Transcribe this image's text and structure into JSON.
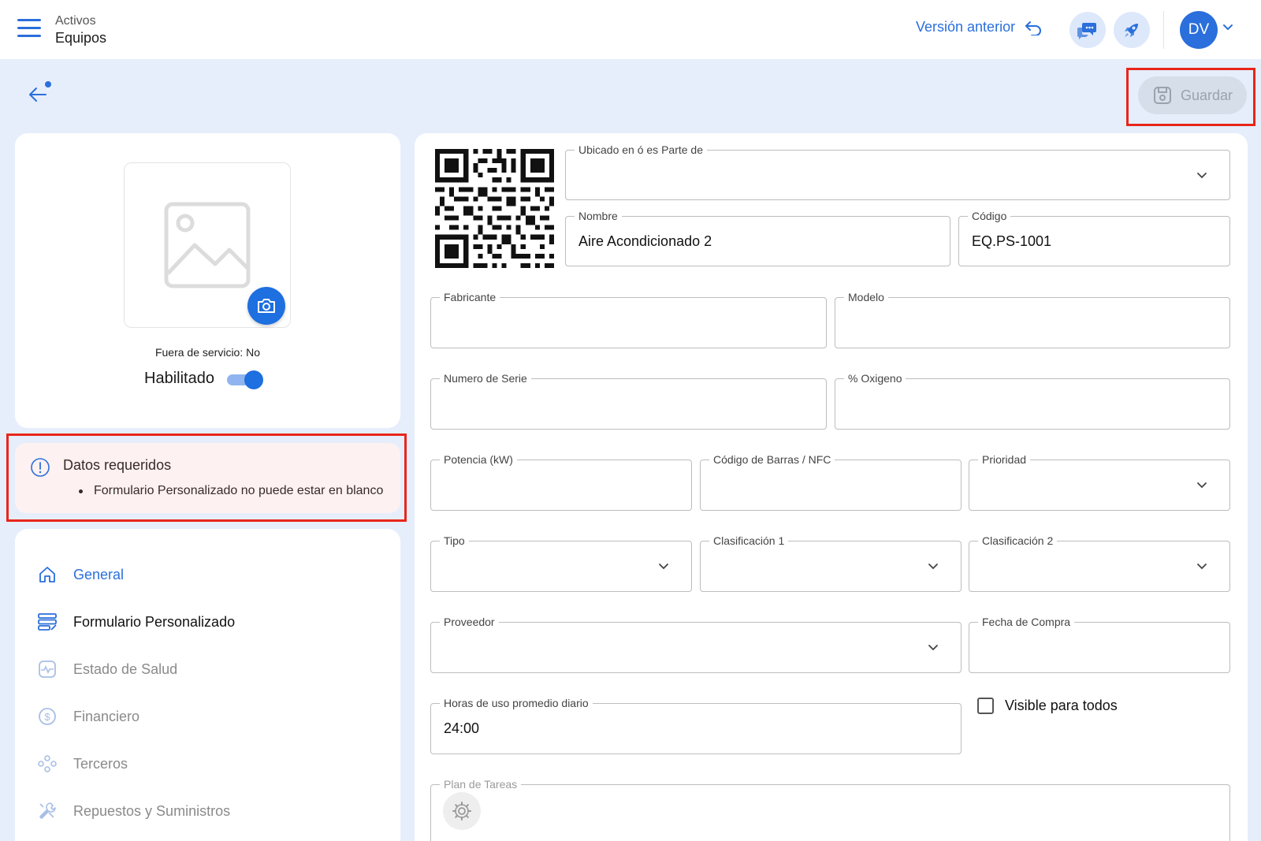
{
  "header": {
    "parent": "Activos",
    "title": "Equipos",
    "previous_version": "Versión anterior",
    "avatar_initials": "DV"
  },
  "toolbar": {
    "save_label": "Guardar"
  },
  "asset": {
    "out_of_service": "Fuera de servicio: No",
    "enabled_label": "Habilitado",
    "enabled": true
  },
  "alert": {
    "title": "Datos requeridos",
    "items": [
      "Formulario Personalizado no puede estar en blanco"
    ]
  },
  "nav": {
    "items": [
      {
        "label": "General",
        "icon": "home-icon",
        "state": "active"
      },
      {
        "label": "Formulario Personalizado",
        "icon": "form-icon",
        "state": "normal"
      },
      {
        "label": "Estado de Salud",
        "icon": "health-icon",
        "state": "disabled"
      },
      {
        "label": "Financiero",
        "icon": "dollar-icon",
        "state": "disabled"
      },
      {
        "label": "Terceros",
        "icon": "people-icon",
        "state": "disabled"
      },
      {
        "label": "Repuestos y Suministros",
        "icon": "tools-icon",
        "state": "disabled"
      }
    ]
  },
  "form": {
    "ubicado": {
      "label": "Ubicado en ó es Parte de",
      "value": ""
    },
    "nombre": {
      "label": "Nombre",
      "value": "Aire Acondicionado 2"
    },
    "codigo": {
      "label": "Código",
      "value": "EQ.PS-1001"
    },
    "fabricante": {
      "label": "Fabricante",
      "value": ""
    },
    "modelo": {
      "label": "Modelo",
      "value": ""
    },
    "serie": {
      "label": "Numero de Serie",
      "value": ""
    },
    "oxigeno": {
      "label": "% Oxigeno",
      "value": ""
    },
    "potencia": {
      "label": "Potencia (kW)",
      "value": ""
    },
    "barras": {
      "label": "Código de Barras / NFC",
      "value": ""
    },
    "prioridad": {
      "label": "Prioridad",
      "value": ""
    },
    "tipo": {
      "label": "Tipo",
      "value": ""
    },
    "clasificacion1": {
      "label": "Clasificación 1",
      "value": ""
    },
    "clasificacion2": {
      "label": "Clasificación 2",
      "value": ""
    },
    "proveedor": {
      "label": "Proveedor",
      "value": ""
    },
    "fecha_compra": {
      "label": "Fecha de Compra",
      "value": ""
    },
    "horas_uso": {
      "label": "Horas de uso promedio diario",
      "value": "24:00"
    },
    "visible_todos": {
      "label": "Visible para todos",
      "checked": false
    },
    "plan_tareas": {
      "label": "Plan de Tareas"
    }
  },
  "colors": {
    "accent": "#2a6fdb",
    "highlight": "#e8261a",
    "alert_bg": "#fdf1f1",
    "page_bg": "#e6eefc"
  }
}
